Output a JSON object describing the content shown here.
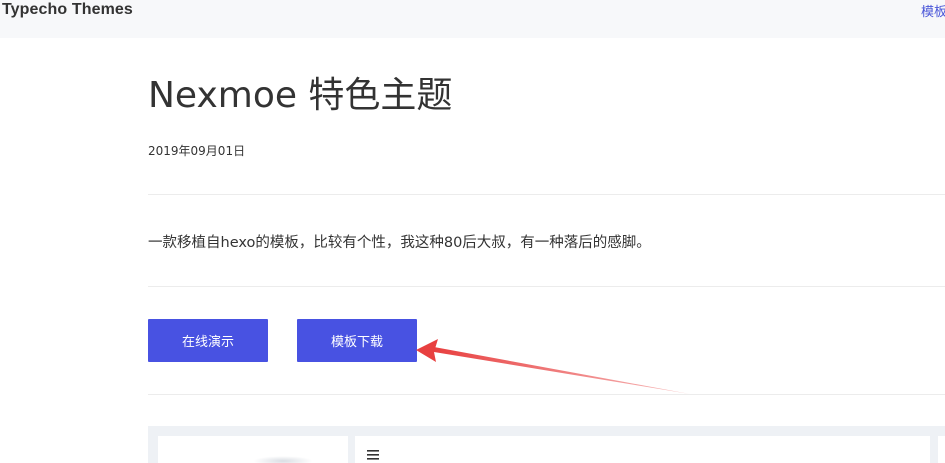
{
  "header": {
    "brand": "Typecho Themes",
    "nav_link": "模板"
  },
  "post": {
    "title": "Nexmoe 特色主题",
    "date": "2019年09月01日",
    "description": "一款移植自hexo的模板，比较有个性，我这种80后大叔，有一种落后的感脚。"
  },
  "buttons": {
    "demo_label": "在线演示",
    "download_label": "模板下载"
  },
  "colors": {
    "accent": "#4852e2",
    "nav_link": "#4a56d8",
    "annotation": "#e84040",
    "topbar_bg": "#f7f8fa"
  },
  "icons": {
    "preview_menu": "hamburger-menu-icon"
  }
}
